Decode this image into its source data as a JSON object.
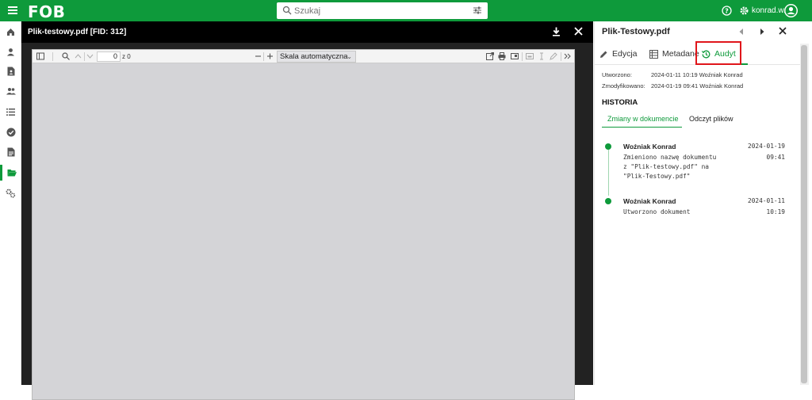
{
  "app": {
    "logo": "FOB"
  },
  "search": {
    "placeholder": "Szukaj"
  },
  "user": {
    "name": "konrad.w..."
  },
  "sidebar": {
    "items": [
      {
        "icon": "home-icon"
      },
      {
        "icon": "person-icon"
      },
      {
        "icon": "document-person-icon"
      },
      {
        "icon": "people-icon"
      },
      {
        "icon": "list-icon"
      },
      {
        "icon": "check-circle-icon"
      },
      {
        "icon": "document-icon"
      },
      {
        "icon": "folder-open-icon"
      },
      {
        "icon": "settings-icon"
      }
    ],
    "active_index": 7
  },
  "viewer": {
    "title": "Plik-testowy.pdf [FID: 312]",
    "page_number": "0",
    "page_of": "z 0",
    "zoom": "Skala automatyczna"
  },
  "panel": {
    "title": "Plik-Testowy.pdf",
    "tabs": [
      {
        "label": "Edycja",
        "icon": "pencil-icon"
      },
      {
        "label": "Metadane",
        "icon": "table-icon"
      },
      {
        "label": "Audyt",
        "icon": "history-icon"
      }
    ],
    "active_tab": "Audyt",
    "created_label": "Utworzono:",
    "created_value": "2024-01-11 10:19 Woźniak Konrad",
    "modified_label": "Zmodyfikowano:",
    "modified_value": "2024-01-19 09:41 Woźniak Konrad",
    "history_heading": "HISTORIA",
    "subtabs": [
      "Zmiany w dokumencie",
      "Odczyt plików"
    ],
    "events": [
      {
        "author": "Woźniak Konrad",
        "text": "Zmieniono nazwę dokumentu z \"Plik-testowy.pdf\" na \"Plik-Testowy.pdf\"",
        "date": "2024-01-19",
        "time": "09:41"
      },
      {
        "author": "Woźniak Konrad",
        "text": "Utworzono dokument",
        "date": "2024-01-11",
        "time": "10:19"
      }
    ]
  },
  "colors": {
    "brand": "#0e9a3b",
    "highlight": "#e0161b"
  }
}
